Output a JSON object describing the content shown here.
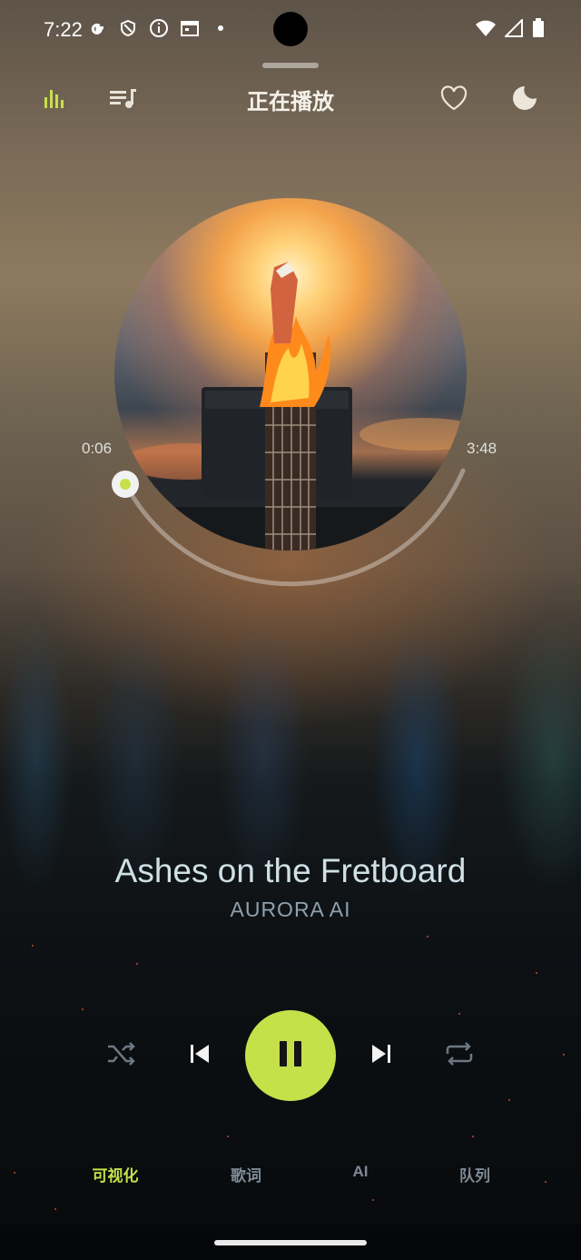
{
  "status_bar": {
    "time": "7:22",
    "left_icons": [
      "google-icon",
      "shield-icon",
      "info-icon",
      "calendar-icon",
      "dot-icon"
    ],
    "right_icons": [
      "wifi-icon",
      "signal-icon",
      "battery-icon"
    ]
  },
  "header": {
    "title": "正在播放",
    "left_icons": [
      "equalizer-icon",
      "playlist-icon"
    ],
    "right_icons": [
      "heart-icon",
      "moon-icon"
    ]
  },
  "player": {
    "elapsed": "0:06",
    "duration": "3:48",
    "progress_fraction": 0.026,
    "song_title": "Ashes on the Fretboard",
    "artist": "AURORA AI"
  },
  "controls": {
    "icons": [
      "shuffle-icon",
      "previous-icon",
      "pause-icon",
      "next-icon",
      "repeat-icon"
    ],
    "state": "playing"
  },
  "tabs": [
    {
      "label": "可视化",
      "active": true
    },
    {
      "label": "歌词",
      "active": false
    },
    {
      "label": "AI",
      "active": false
    },
    {
      "label": "队列",
      "active": false
    }
  ],
  "colors": {
    "accent": "#c6e04a",
    "title_text": "#cfe0e6",
    "artist_text": "#8fa0ad",
    "inactive_tab": "#7d8a96"
  }
}
